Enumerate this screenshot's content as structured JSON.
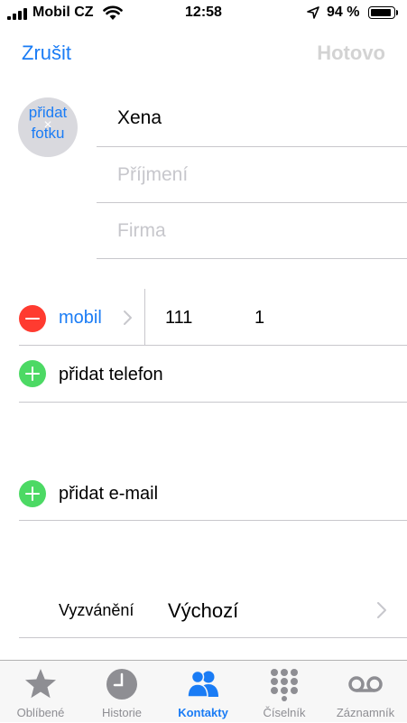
{
  "status_bar": {
    "carrier": "Mobil CZ",
    "time": "12:58",
    "battery": "94 %",
    "battery_level": 0.94
  },
  "nav": {
    "cancel_label": "Zrušit",
    "done_label": "Hotovo"
  },
  "photo": {
    "label_line1": "přidat",
    "label_line2": "fotku",
    "remove_glyph": "×"
  },
  "name_fields": {
    "first_name": "Xena",
    "last_name_placeholder": "Příjmení",
    "company_placeholder": "Firma"
  },
  "phone": {
    "label": "mobil",
    "value_part1": "111",
    "value_part2": "1",
    "add_label": "přidat telefon"
  },
  "email": {
    "add_label": "přidat e-mail"
  },
  "ringtone": {
    "label": "Vyzvánění",
    "value": "Výchozí"
  },
  "tabbar": {
    "tabs": [
      {
        "label": "Oblíbené",
        "icon": "star-icon"
      },
      {
        "label": "Historie",
        "icon": "clock-icon"
      },
      {
        "label": "Kontakty",
        "icon": "contacts-icon",
        "active": true
      },
      {
        "label": "Číselník",
        "icon": "keypad-icon"
      },
      {
        "label": "Záznamník",
        "icon": "voicemail-icon"
      }
    ]
  },
  "colors": {
    "accent": "#1a7cf5",
    "disabled": "#d3d3d3",
    "delete_red": "#ff3b30",
    "add_green": "#4cd964",
    "inactive_gray": "#8e8e93",
    "separator": "#c8c7cc"
  }
}
